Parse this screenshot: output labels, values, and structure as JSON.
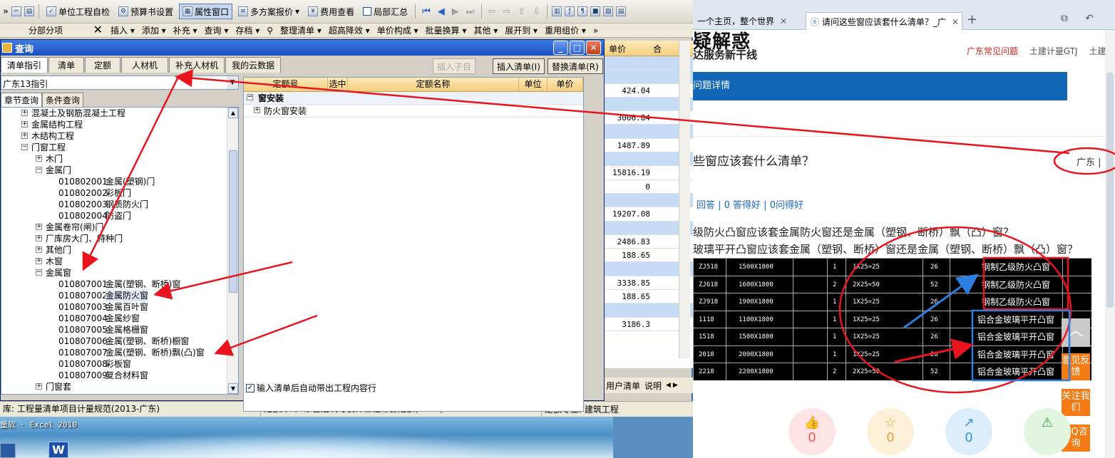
{
  "toolbar": {
    "items": [
      "单位工程自检",
      "预算书设置",
      "属性窗口",
      "多方案报价",
      "费用查看",
      "局部汇总"
    ],
    "multi_plan_arrow": "▾",
    "chevrons": "»"
  },
  "toolbar2": {
    "fenbu_label": "分部分项",
    "items": [
      "插入 ▾",
      "添加 ▾",
      "补充 ▾",
      "查询 ▾",
      "存档 ▾",
      "整理清单 ▾",
      "超高降效 ▾",
      "单价构成 ▾",
      "批量换算 ▾",
      "其他 ▾",
      "展开到 ▾",
      "重用组价 ▾"
    ],
    "chevrons": "»"
  },
  "background_grid": {
    "header": [
      "单价",
      "合"
    ],
    "values": [
      "",
      "",
      "424.04",
      "",
      "3006.84",
      "",
      "1487.89",
      "",
      "15816.19",
      "0",
      "",
      "19207.08",
      "",
      "2486.83",
      "188.65",
      "",
      "3338.85",
      "188.65",
      "",
      "3186.3"
    ],
    "bottom_tabs": [
      "用户清单",
      "说明"
    ]
  },
  "dialog": {
    "title": "查询",
    "tabs": [
      "清单指引",
      "清单",
      "定额",
      "人材机",
      "补充人材机",
      "我的云数据"
    ],
    "btn_insert_child": "插入子目",
    "btn_insert_list": "插入清单(I)",
    "btn_replace_list": "替换清单(R)",
    "combo_value": "广东13指引",
    "subtabs": [
      "章节查询",
      "条件查询"
    ],
    "tree": [
      {
        "level": 1,
        "exp": "+",
        "text": "混凝土及钢筋混凝土工程"
      },
      {
        "level": 1,
        "exp": "+",
        "text": "金属结构工程"
      },
      {
        "level": 1,
        "exp": "+",
        "text": "木结构工程"
      },
      {
        "level": 1,
        "exp": "−",
        "text": "门窗工程"
      },
      {
        "level": 2,
        "exp": "+",
        "text": "木门"
      },
      {
        "level": 2,
        "exp": "−",
        "text": "金属门"
      },
      {
        "level": 3,
        "exp": "",
        "code": "010802001",
        "text": "金属(塑钢)门"
      },
      {
        "level": 3,
        "exp": "",
        "code": "010802002",
        "text": "彩板门"
      },
      {
        "level": 3,
        "exp": "",
        "code": "010802003",
        "text": "钢质防火门"
      },
      {
        "level": 3,
        "exp": "",
        "code": "010802004",
        "text": "防盗门"
      },
      {
        "level": 2,
        "exp": "+",
        "text": "金属卷帘(闸)门"
      },
      {
        "level": 2,
        "exp": "+",
        "text": "厂库房大门、特种门"
      },
      {
        "level": 2,
        "exp": "+",
        "text": "其他门"
      },
      {
        "level": 2,
        "exp": "+",
        "text": "木窗"
      },
      {
        "level": 2,
        "exp": "−",
        "text": "金属窗"
      },
      {
        "level": 3,
        "exp": "",
        "code": "010807001",
        "text": "金属(塑钢、断桥)窗"
      },
      {
        "level": 3,
        "exp": "",
        "code": "010807002",
        "text": "金属防火窗",
        "highlight": true
      },
      {
        "level": 3,
        "exp": "",
        "code": "010807003",
        "text": "金属百叶窗"
      },
      {
        "level": 3,
        "exp": "",
        "code": "010807004",
        "text": "金属纱窗"
      },
      {
        "level": 3,
        "exp": "",
        "code": "010807005",
        "text": "金属格栅窗"
      },
      {
        "level": 3,
        "exp": "",
        "code": "010807006",
        "text": "金属(塑钢、断桥)橱窗"
      },
      {
        "level": 3,
        "exp": "",
        "code": "010807007",
        "text": "金属(塑钢、断桥)飘(凸)窗"
      },
      {
        "level": 3,
        "exp": "",
        "code": "010807008",
        "text": "彩板窗"
      },
      {
        "level": 3,
        "exp": "",
        "code": "010807009",
        "text": "复合材料窗"
      },
      {
        "level": 2,
        "exp": "+",
        "text": "门窗套"
      }
    ],
    "grid_headers": [
      "定额号",
      "选中",
      "定额名称",
      "单位",
      "单价"
    ],
    "grid_rows": [
      {
        "exp": "−",
        "text": "窗安装",
        "group": true
      },
      {
        "exp": "+",
        "text": "防火窗安装",
        "group": false
      }
    ],
    "checkbox_label": "输入清单后自动带出工程内容行",
    "checkbox_checked": "✓"
  },
  "statusbar": {
    "left": "库: 工程量清单项目计量规范(2013-广东)",
    "middle": "定额库: 广东省建筑与装饰工程综合定额(2010)",
    "right": "定额专业: 建筑工程"
  },
  "desktop": {
    "label": "量软 · Excel 2010",
    "word_letter": "W"
  },
  "browser": {
    "tabs": [
      {
        "title": "一个主页，整个世界",
        "active": false
      },
      {
        "title": "请问这些窗应该套什么清单？_广",
        "active": true
      }
    ],
    "plus": "+",
    "tools": "⧉ ↶",
    "logo": "疑解惑",
    "sub": "达服务新干线",
    "links_red": "广东常见问题",
    "links_gray": [
      "土建计量GTJ",
      "土建"
    ],
    "bluebar": "问题详情",
    "question_title": "些窗应该套什么清单？",
    "region": "广东 |",
    "stats": "回答 | 0 答得好 | 0问得好",
    "text1": "级防火凸窗应该套金属防火窗还是金属（塑钢、断桥）飘（凸）窗？",
    "text2": "玻璃平开凸窗应该套金属（塑钢、断桥）窗还是金属（塑钢、断桥）飘（凸）窗？",
    "cad_rows": [
      {
        "id": "ZJ518",
        "size": "1500X1800",
        "n": "1",
        "calc": "1X25=25",
        "v": "26",
        "desc": "钢制乙级防火凸窗"
      },
      {
        "id": "ZJ618",
        "size": "1600X1800",
        "n": "2",
        "calc": "2X25=50",
        "v": "52",
        "desc": "钢制乙级防火凸窗"
      },
      {
        "id": "ZJ918",
        "size": "1900X1800",
        "n": "1",
        "calc": "1X25=25",
        "v": "26",
        "desc": "钢制乙级防火凸窗"
      },
      {
        "id": "1118",
        "size": "1100X1800",
        "n": "1",
        "calc": "1X25=25",
        "v": "26",
        "desc": "铝合金玻璃平开凸窗"
      },
      {
        "id": "1518",
        "size": "1500X1800",
        "n": "1",
        "calc": "1X25=25",
        "v": "26",
        "desc": "铝合金玻璃平开凸窗"
      },
      {
        "id": "2018",
        "size": "2000X1800",
        "n": "1",
        "calc": "1X25=25",
        "v": "26",
        "desc": "铝合金玻璃平开凸窗"
      },
      {
        "id": "2218",
        "size": "2200X1800",
        "n": "2",
        "calc": "2X25=50",
        "v": "52",
        "desc": "铝合金玻璃平开凸窗"
      }
    ],
    "float_btns": [
      "意见反馈",
      "关注我们",
      "QQ咨询"
    ],
    "bubbles": [
      {
        "icon": "👍",
        "count": "0",
        "color": "#fde3e3",
        "fg": "#e7595a"
      },
      {
        "icon": "☆",
        "count": "0",
        "color": "#fdf0d8",
        "fg": "#e6a33a"
      },
      {
        "icon": "↗",
        "count": "0",
        "color": "#dcedfb",
        "fg": "#3b8fd9"
      },
      {
        "icon": "⚠",
        "count": "",
        "color": "#e1f5e1",
        "fg": "#3aa34c"
      }
    ]
  },
  "colors": {
    "annotation_red": "#e8141e",
    "annotation_blue": "#2d7fe0",
    "accent_blue": "#1266b8"
  }
}
